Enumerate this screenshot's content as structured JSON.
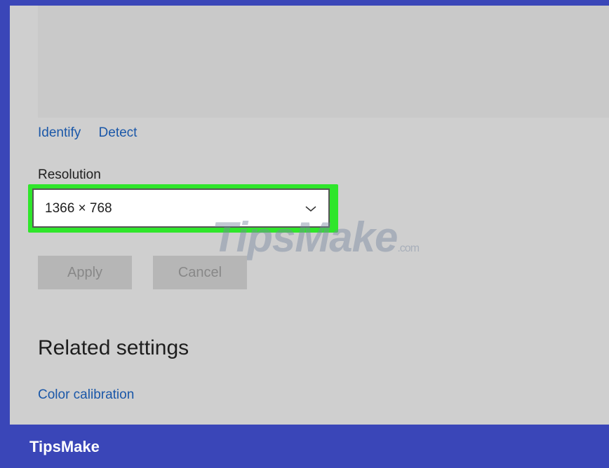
{
  "display": {
    "identify_label": "Identify",
    "detect_label": "Detect",
    "resolution_label": "Resolution",
    "resolution_value": "1366 × 768",
    "apply_label": "Apply",
    "cancel_label": "Cancel",
    "related_heading": "Related settings",
    "color_calibration_label": "Color calibration"
  },
  "watermark": {
    "text": "TipsMake",
    "suffix": ".com"
  },
  "footer": {
    "brand": "TipsMake"
  },
  "colors": {
    "accent_link": "#1a57a8",
    "highlight": "#2fe62b",
    "frame_border": "#3a46b8"
  },
  "icons": {
    "dropdown": "chevron-down-icon"
  }
}
